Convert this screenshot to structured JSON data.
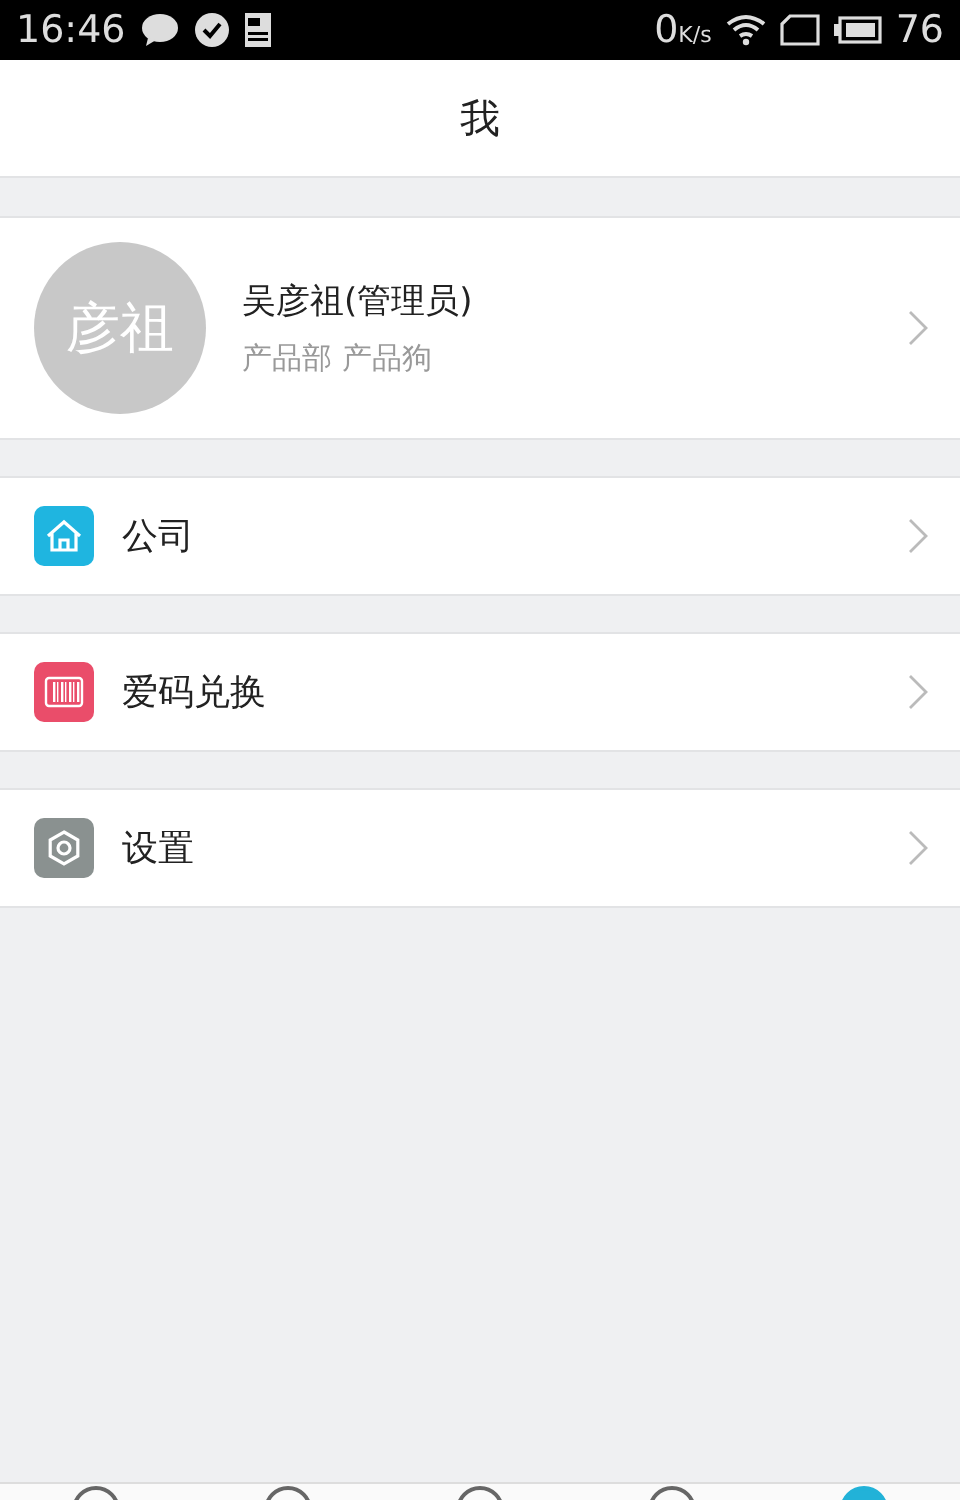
{
  "status_bar": {
    "time": "16:46",
    "speed": "0",
    "speed_unit": "K/s",
    "battery": "76"
  },
  "header": {
    "title": "我"
  },
  "profile": {
    "avatar_text": "彦祖",
    "name": "吴彦祖(管理员)",
    "subtitle": "产品部 产品狗"
  },
  "menu": [
    {
      "kind": "home",
      "label": "公司",
      "color": "#1fb5e0"
    },
    {
      "kind": "barcode",
      "label": "爱码兑换",
      "color": "#ea4d6a"
    },
    {
      "kind": "gear",
      "label": "设置",
      "color": "#8a9190"
    }
  ],
  "tab_bar": [
    {
      "selected": false
    },
    {
      "selected": false
    },
    {
      "selected": false
    },
    {
      "selected": false
    },
    {
      "selected": true
    }
  ]
}
